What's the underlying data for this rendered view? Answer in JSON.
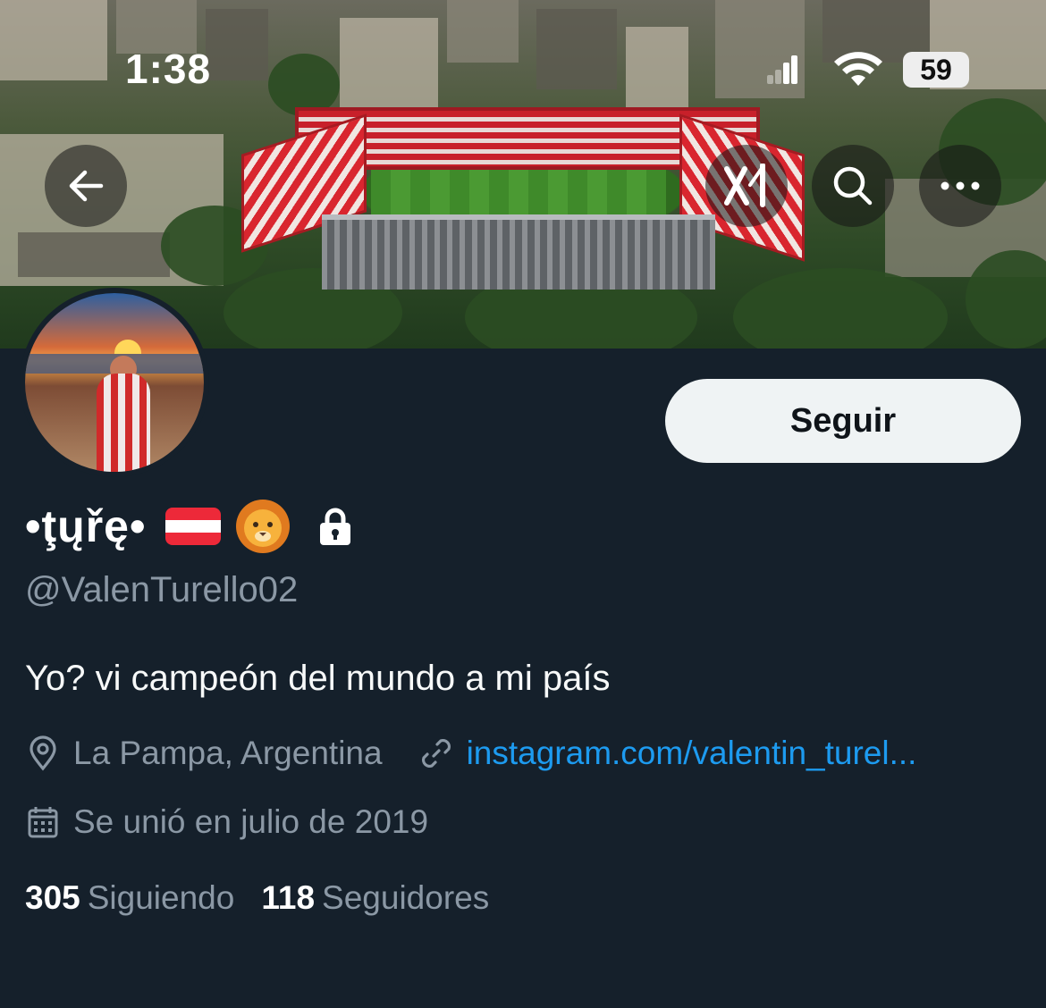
{
  "status_bar": {
    "time": "1:38",
    "battery": "59"
  },
  "header": {
    "back_icon": "arrow-left-icon",
    "grok_icon": "grok-icon",
    "search_icon": "search-icon",
    "more_icon": "more-horizontal-icon"
  },
  "profile": {
    "display_name": "•ţųřę•",
    "handle": "@ValenTurello02",
    "bio": "Yo? vi campeón del mundo a mi país",
    "location": "La Pampa, Argentina",
    "website": "instagram.com/valentin_turel...",
    "joined": "Se unió en julio de 2019",
    "following_count": "305",
    "following_label": "Siguiendo",
    "followers_count": "118",
    "followers_label": "Seguidores",
    "protected": true
  },
  "actions": {
    "follow_label": "Seguir"
  },
  "colors": {
    "background": "#15202b",
    "link": "#1d9bf0",
    "secondary_text": "#8b98a5",
    "follow_button_bg": "#eff3f4"
  }
}
